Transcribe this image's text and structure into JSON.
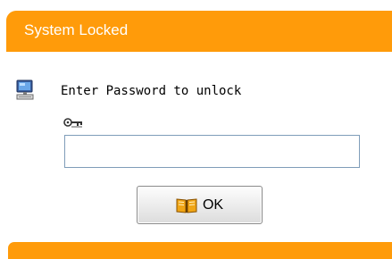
{
  "window": {
    "title": "System Locked",
    "accent_color": "#ff9b0a"
  },
  "prompt": {
    "text": "Enter Password to unlock",
    "icon": "computer-icon"
  },
  "password": {
    "icon": "key-icon",
    "value": "",
    "placeholder": ""
  },
  "ok_button": {
    "label": "OK",
    "icon": "book-icon"
  }
}
